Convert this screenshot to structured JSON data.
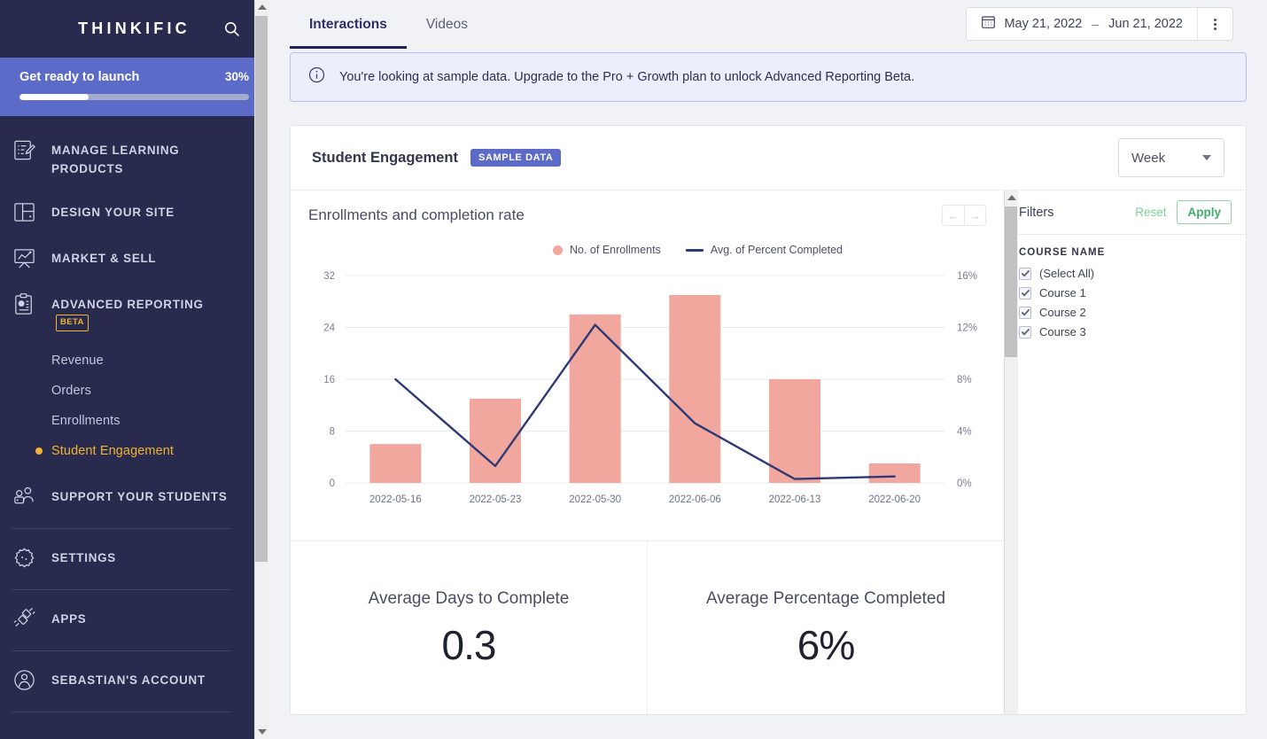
{
  "sidebar": {
    "brand": "THINKIFIC",
    "search_icon": "search-icon",
    "launch": {
      "title": "Get ready to launch",
      "percent_label": "30%",
      "percent_value": 30
    },
    "items": [
      {
        "label": "MANAGE LEARNING PRODUCTS",
        "icon": "edit-document-icon"
      },
      {
        "label": "DESIGN YOUR SITE",
        "icon": "layout-icon"
      },
      {
        "label": "MARKET & SELL",
        "icon": "presentation-chart-icon"
      },
      {
        "label": "ADVANCED REPORTING",
        "icon": "clipboard-chart-icon",
        "badge": "BETA"
      },
      {
        "label": "SUPPORT YOUR STUDENTS",
        "icon": "people-icon"
      },
      {
        "label": "SETTINGS",
        "icon": "gear-icon"
      },
      {
        "label": "APPS",
        "icon": "plug-icon"
      },
      {
        "label": "SEBASTIAN'S ACCOUNT",
        "icon": "user-circle-icon"
      }
    ],
    "subitems": [
      {
        "label": "Revenue",
        "active": false
      },
      {
        "label": "Orders",
        "active": false
      },
      {
        "label": "Enrollments",
        "active": false
      },
      {
        "label": "Student Engagement",
        "active": true
      }
    ]
  },
  "header": {
    "tabs": [
      {
        "label": "Interactions",
        "active": true
      },
      {
        "label": "Videos",
        "active": false
      }
    ],
    "date_range": {
      "icon": "calendar-icon",
      "start": "May 21, 2022",
      "separator": "–",
      "end": "Jun 21, 2022"
    },
    "kebab_icon": "kebab-menu-icon"
  },
  "banner": {
    "icon": "info-icon",
    "text": "You're looking at sample data. Upgrade to the Pro + Growth plan to unlock Advanced Reporting Beta."
  },
  "card": {
    "title": "Student Engagement",
    "badge": "SAMPLE DATA",
    "period_select": {
      "value": "Week",
      "icon": "chevron-down-icon"
    }
  },
  "chart_nav": {
    "prev": "←",
    "next": "→"
  },
  "chart_data": {
    "type": "bar",
    "title": "Enrollments and completion rate",
    "categories": [
      "2022-05-16",
      "2022-05-23",
      "2022-05-30",
      "2022-06-06",
      "2022-06-13",
      "2022-06-20"
    ],
    "series": [
      {
        "name": "No. of Enrollments",
        "type": "bar",
        "color": "#f2a79e",
        "axis": "left",
        "values": [
          6,
          13,
          26,
          29,
          16,
          3
        ]
      },
      {
        "name": "Avg. of Percent Completed",
        "type": "line",
        "color": "#2e3a75",
        "axis": "right",
        "values": [
          8.0,
          1.3,
          12.2,
          4.6,
          0.3,
          0.5
        ]
      }
    ],
    "left_axis": {
      "label": "",
      "ticks": [
        0,
        8,
        16,
        24,
        32
      ],
      "ylim": [
        0,
        32
      ]
    },
    "right_axis": {
      "label": "",
      "ticks": [
        "0%",
        "4%",
        "8%",
        "12%",
        "16%"
      ],
      "ylim": [
        0,
        16
      ]
    },
    "xlabel": "",
    "grid": true,
    "legend": [
      "No. of Enrollments",
      "Avg. of Percent Completed"
    ],
    "legend_position": "top-center"
  },
  "stats": [
    {
      "label": "Average Days to Complete",
      "value": "0.3"
    },
    {
      "label": "Average Percentage Completed",
      "value": "6%"
    }
  ],
  "filters": {
    "title": "Filters",
    "reset_label": "Reset",
    "apply_label": "Apply",
    "group_label": "COURSE NAME",
    "options": [
      {
        "label": "(Select All)",
        "checked": true
      },
      {
        "label": "Course 1",
        "checked": true
      },
      {
        "label": "Course 2",
        "checked": true
      },
      {
        "label": "Course 3",
        "checked": true
      }
    ]
  },
  "colors": {
    "sidebar_bg": "#282a4e",
    "launch_bg": "#5c6bc7",
    "accent_yellow": "#f2b233",
    "bar": "#f2a79e",
    "line": "#2e3a75",
    "banner_bg": "#eceefb",
    "green": "#3fae6a"
  }
}
